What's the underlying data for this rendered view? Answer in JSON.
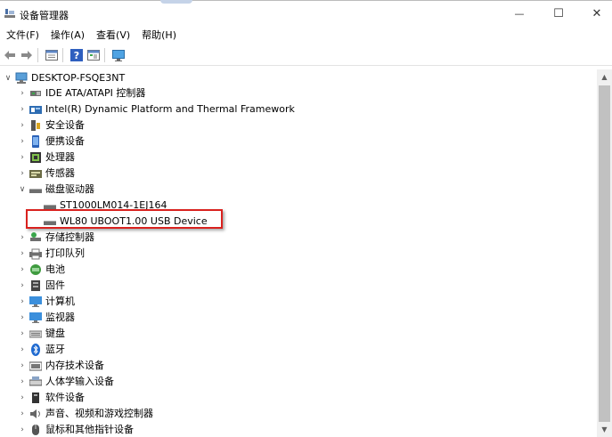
{
  "window": {
    "title": "设备管理器",
    "controls": {
      "minimize": "—",
      "maximize": "☐",
      "close": "✕"
    }
  },
  "menu": [
    "文件(F)",
    "操作(A)",
    "查看(V)",
    "帮助(H)"
  ],
  "toolbar": [
    "back-arrow-icon",
    "forward-arrow-icon",
    "properties-icon",
    "help-icon",
    "view-icon",
    "monitor-icon"
  ],
  "tree": {
    "root": "DESKTOP-FSQE3NT",
    "items": [
      {
        "label": "IDE ATA/ATAPI 控制器",
        "icon": "ide-controller-icon",
        "expanded": false
      },
      {
        "label": "Intel(R) Dynamic Platform and Thermal Framework",
        "icon": "intel-framework-icon",
        "expanded": false
      },
      {
        "label": "安全设备",
        "icon": "security-device-icon",
        "expanded": false
      },
      {
        "label": "便携设备",
        "icon": "portable-device-icon",
        "expanded": false
      },
      {
        "label": "处理器",
        "icon": "processor-icon",
        "expanded": false
      },
      {
        "label": "传感器",
        "icon": "sensor-icon",
        "expanded": false
      },
      {
        "label": "磁盘驱动器",
        "icon": "disk-drive-icon",
        "expanded": true,
        "children": [
          {
            "label": "ST1000LM014-1EJ164",
            "icon": "disk-icon"
          },
          {
            "label": "WL80 UBOOT1.00 USB Device",
            "icon": "disk-icon",
            "highlighted": true
          }
        ]
      },
      {
        "label": "存储控制器",
        "icon": "storage-controller-icon",
        "expanded": false
      },
      {
        "label": "打印队列",
        "icon": "print-queue-icon",
        "expanded": false
      },
      {
        "label": "电池",
        "icon": "battery-icon",
        "expanded": false
      },
      {
        "label": "固件",
        "icon": "firmware-icon",
        "expanded": false
      },
      {
        "label": "计算机",
        "icon": "computer-icon",
        "expanded": false
      },
      {
        "label": "监视器",
        "icon": "monitor-icon",
        "expanded": false
      },
      {
        "label": "键盘",
        "icon": "keyboard-icon",
        "expanded": false
      },
      {
        "label": "蓝牙",
        "icon": "bluetooth-icon",
        "expanded": false
      },
      {
        "label": "内存技术设备",
        "icon": "memory-device-icon",
        "expanded": false
      },
      {
        "label": "人体学输入设备",
        "icon": "hid-icon",
        "expanded": false
      },
      {
        "label": "软件设备",
        "icon": "software-device-icon",
        "expanded": false
      },
      {
        "label": "声音、视频和游戏控制器",
        "icon": "sound-icon",
        "expanded": false
      },
      {
        "label": "鼠标和其他指针设备",
        "icon": "mouse-icon",
        "expanded": false
      }
    ]
  },
  "colors": {
    "highlight_border": "#d9211e",
    "scroll_thumb": "#c1c1c1"
  }
}
